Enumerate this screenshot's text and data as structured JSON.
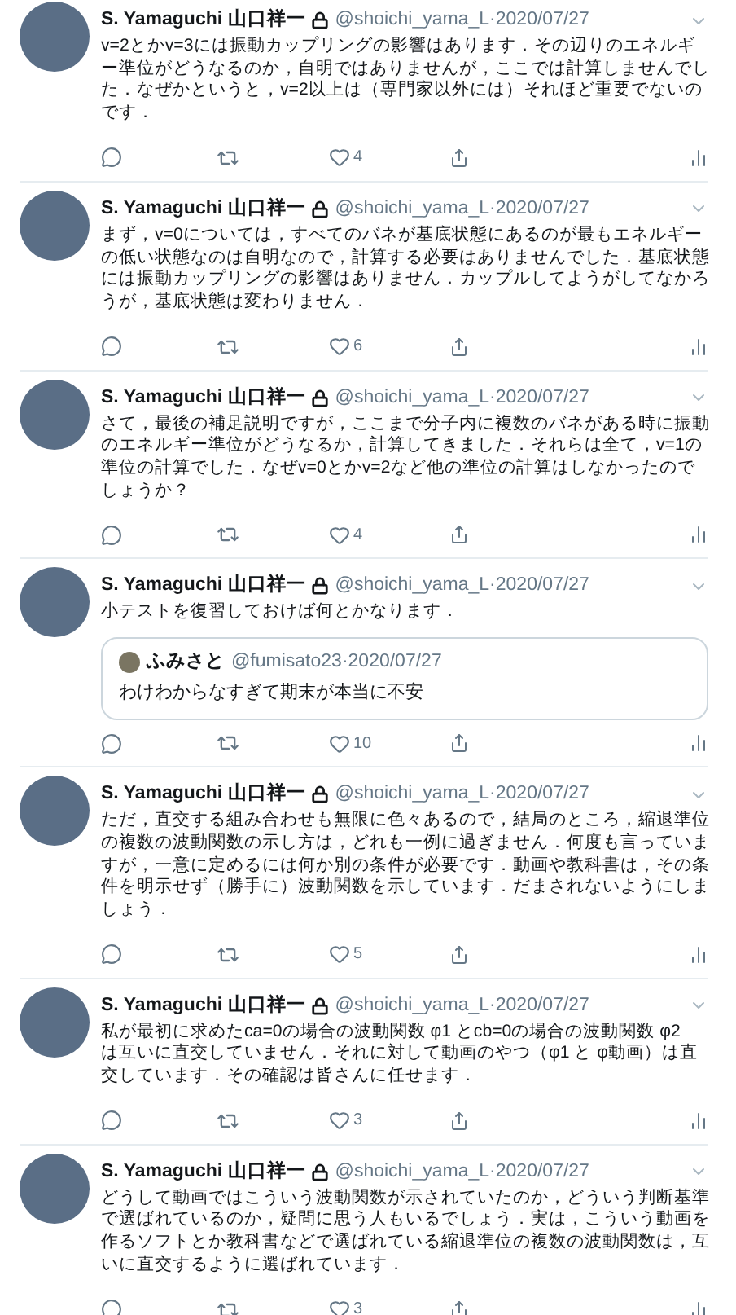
{
  "tweets": [
    {
      "name": "S. Yamaguchi 山口祥一",
      "handle": "@shoichi_yama_L",
      "separator": "·",
      "date": "2020/07/27",
      "lines": [
        "v=2とかv=3には振動カップリングの影響はあります．その辺りのエネルギ",
        "ー準位がどうなるのか，自明ではありませんが，ここでは計算しませんでし",
        "た．なぜかというと，v=2以上は（専門家以外には）それほど重要でないの",
        "です．"
      ],
      "likes": "4"
    },
    {
      "name": "S. Yamaguchi 山口祥一",
      "handle": "@shoichi_yama_L",
      "separator": "·",
      "date": "2020/07/27",
      "lines": [
        "まず，v=0については，すべてのバネが基底状態にあるのが最もエネルギー",
        "の低い状態なのは自明なので，計算する必要はありませんでした．基底状態",
        "には振動カップリングの影響はありません．カップルしてようがしてなかろ",
        "うが，基底状態は変わりません．"
      ],
      "likes": "6"
    },
    {
      "name": "S. Yamaguchi 山口祥一",
      "handle": "@shoichi_yama_L",
      "separator": "·",
      "date": "2020/07/27",
      "lines": [
        "さて，最後の補足説明ですが，ここまで分子内に複数のバネがある時に振動",
        "のエネルギー準位がどうなるか，計算してきました．それらは全て，v=1の",
        "準位の計算でした．なぜv=0とかv=2など他の準位の計算はしなかったので",
        "しょうか？"
      ],
      "likes": "4"
    },
    {
      "name": "S. Yamaguchi 山口祥一",
      "handle": "@shoichi_yama_L",
      "separator": "·",
      "date": "2020/07/27",
      "lines": [
        "小テストを復習しておけば何とかなります．"
      ],
      "quote": {
        "name": "ふみさと",
        "handle": "@fumisato23",
        "separator": "·",
        "date": "2020/07/27",
        "text": "わけわからなすぎて期末が本当に不安"
      },
      "likes": "10"
    },
    {
      "name": "S. Yamaguchi 山口祥一",
      "handle": "@shoichi_yama_L",
      "separator": "·",
      "date": "2020/07/27",
      "lines": [
        "ただ，直交する組み合わせも無限に色々あるので，結局のところ，縮退準位",
        "の複数の波動関数の示し方は，どれも一例に過ぎません．何度も言っていま",
        "すが，一意に定めるには何か別の条件が必要です．動画や教科書は，その条",
        "件を明示せず（勝手に）波動関数を示しています．だまされないようにしま",
        "しょう．"
      ],
      "likes": "5"
    },
    {
      "name": "S. Yamaguchi 山口祥一",
      "handle": "@shoichi_yama_L",
      "separator": "·",
      "date": "2020/07/27",
      "lines": [
        "私が最初に求めたca=0の場合の波動関数 φ1 とcb=0の場合の波動関数 φ2",
        "は互いに直交していません．それに対して動画のやつ（φ1 と φ動画）は直",
        "交しています．その確認は皆さんに任せます．"
      ],
      "likes": "3"
    },
    {
      "name": "S. Yamaguchi 山口祥一",
      "handle": "@shoichi_yama_L",
      "separator": "·",
      "date": "2020/07/27",
      "lines": [
        "どうして動画ではこういう波動関数が示されていたのか，どういう判断基準",
        "で選ばれているのか，疑問に思う人もいるでしょう．実は，こういう動画を",
        "作るソフトとか教科書などで選ばれている縮退準位の複数の波動関数は，互",
        "いに直交するように選ばれています．"
      ],
      "likes": "3"
    }
  ]
}
